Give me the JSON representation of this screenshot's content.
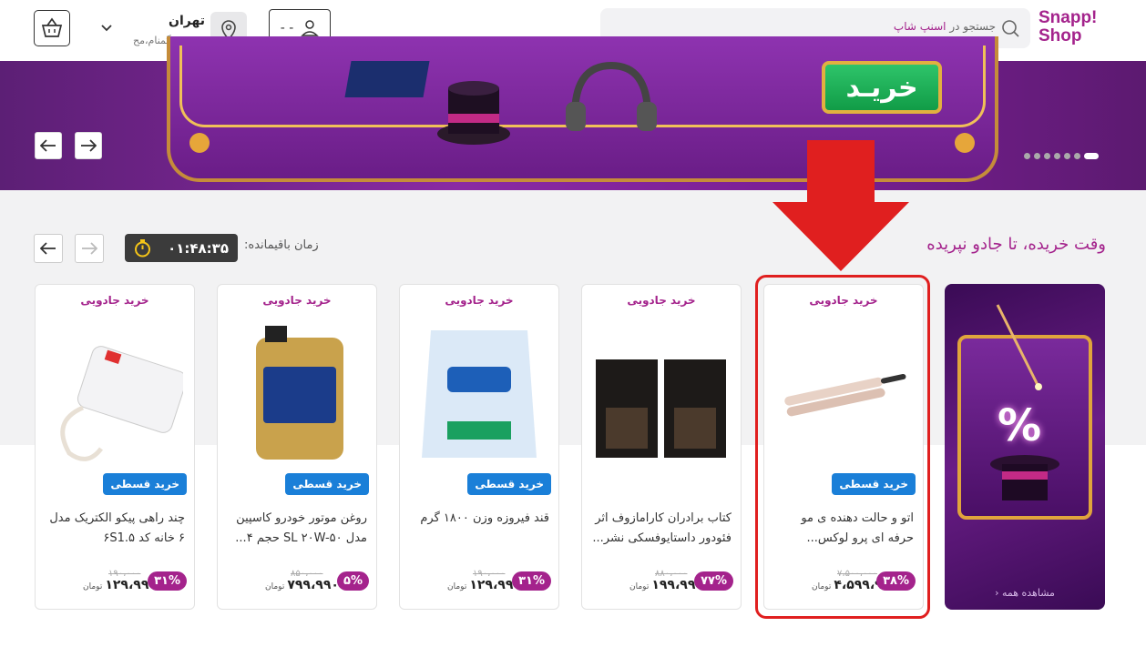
{
  "header": {
    "logo_line1": "Snapp!",
    "logo_line2": "Shop",
    "search_placeholder_prefix": "جستجو در",
    "search_placeholder_brand": "اسنپ شاپ",
    "user_label": "- -",
    "location_city": "تهران",
    "location_sub": "شهید گمنام،مح..."
  },
  "banner": {
    "buy_label": "خریـد",
    "dots_count": 7
  },
  "section": {
    "title": "وقت خریده، تا جادو نپریده",
    "timer_label": "زمان باقیمانده:",
    "timer_value": "۰۱:۴۸:۳۵",
    "see_all": "مشاهده همه"
  },
  "products": [
    {
      "tag": "خرید جادویی",
      "installment": "خرید قسطی",
      "title": "اتو و حالت دهنده ی مو حرفه ای پرو لوکس...",
      "old_price": "۷،۵۰۰،۰۰۰",
      "price": "۴،۵۹۹،۹۹۰",
      "currency": "تومان",
      "discount": "۳۸%"
    },
    {
      "tag": "خرید جادویی",
      "installment": "",
      "title": "کتاب برادران کارامازوف اثر فئودور داستایوفسکی نشر...",
      "old_price": "۸۸۰،۰۰۰",
      "price": "۱۹۹،۹۹۰",
      "currency": "تومان",
      "discount": "۷۷%"
    },
    {
      "tag": "خرید جادویی",
      "installment": "خرید قسطی",
      "title": "قند فیروزه وزن ۱۸۰۰ گرم",
      "old_price": "۱۹۰،۰۰۰",
      "price": "۱۲۹،۹۹۰",
      "currency": "تومان",
      "discount": "۳۱%"
    },
    {
      "tag": "خرید جادویی",
      "installment": "خرید قسطی",
      "title": "روغن موتور خودرو کاسپین مدل SL ۲۰W-۵۰ حجم ۴...",
      "old_price": "۸۵۰،۰۰۰",
      "price": "۷۹۹،۹۹۰",
      "currency": "تومان",
      "discount": "۵%"
    },
    {
      "tag": "خرید جادویی",
      "installment": "خرید قسطی",
      "title": "چند راهی پیکو الکتریک مدل ۶ خانه کد ۶S1.۵",
      "old_price": "۱۹۰،۰۰۰",
      "price": "۱۲۹،۹۹۰",
      "currency": "تومان",
      "discount": "۳۱%"
    }
  ],
  "colors": {
    "brand": "#a4238c",
    "installment": "#1a7fd8",
    "annotation": "#e01f1f"
  }
}
